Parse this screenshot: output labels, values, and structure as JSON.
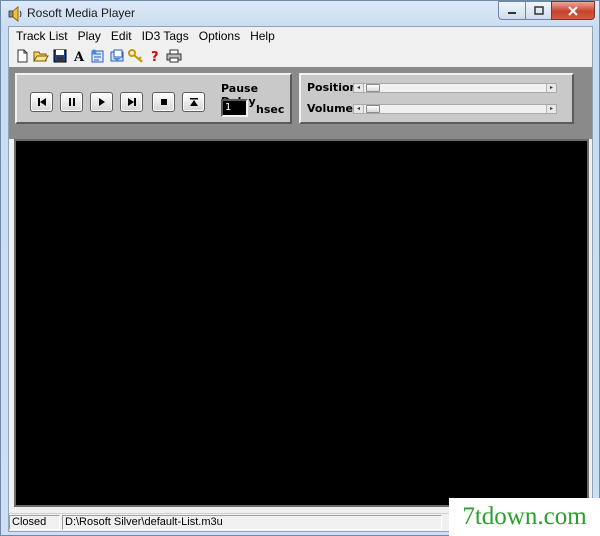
{
  "window": {
    "title": "Rosoft Media Player",
    "icon": "speaker-icon",
    "caption_buttons": [
      "minimize-icon",
      "maximize-icon",
      "close-icon"
    ]
  },
  "menu": {
    "items": [
      {
        "label": "Track List"
      },
      {
        "label": "Play"
      },
      {
        "label": "Edit"
      },
      {
        "label": "ID3 Tags"
      },
      {
        "label": "Options"
      },
      {
        "label": "Help"
      }
    ]
  },
  "toolbar": {
    "icons": [
      "new-file-icon",
      "open-folder-icon",
      "save-icon",
      "font-icon",
      "edit-tags-icon",
      "export-icon",
      "keys-icon",
      "help-icon",
      "print-icon"
    ]
  },
  "controls": {
    "buttons": [
      "previous-track-icon",
      "pause-icon",
      "play-icon",
      "next-track-icon",
      "stop-icon",
      "eject-icon"
    ],
    "pause_delay_label": "Pause Delay",
    "pause_delay_value": "1",
    "pause_delay_unit": "hsec"
  },
  "sliders": {
    "position_label": "Position",
    "volume_label": "Volume",
    "position_level": 0.0,
    "volume_level": 0.0
  },
  "status": {
    "state": "Closed",
    "playlist_path": "D:\\Rosoft Silver\\default-List.m3u"
  },
  "watermark": {
    "text": "7tdown.com",
    "color": "#2c9e2c"
  },
  "colors": {
    "display_bg": "#000000",
    "panel_bg": "#c9c9c9",
    "panel_frame": "#8a8a8a",
    "close_button": "#c7442c"
  }
}
